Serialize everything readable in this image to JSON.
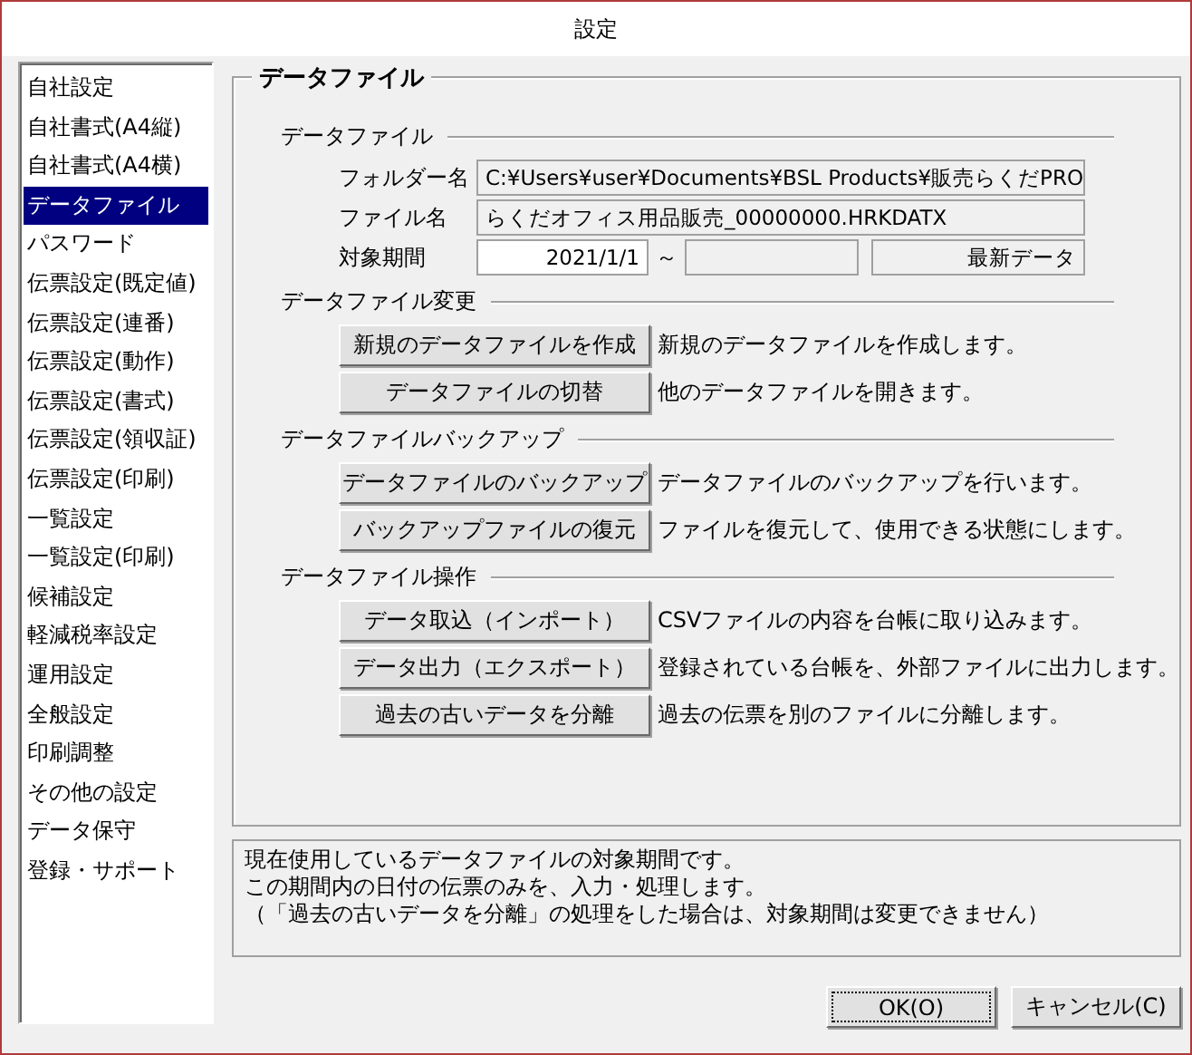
{
  "window": {
    "title": "設定"
  },
  "sidebar": {
    "items": [
      {
        "label": "自社設定",
        "selected": false
      },
      {
        "label": "自社書式(A4縦)",
        "selected": false
      },
      {
        "label": "自社書式(A4横)",
        "selected": false
      },
      {
        "label": "データファイル",
        "selected": true
      },
      {
        "label": "パスワード",
        "selected": false
      },
      {
        "label": "伝票設定(既定値)",
        "selected": false
      },
      {
        "label": "伝票設定(連番)",
        "selected": false
      },
      {
        "label": "伝票設定(動作)",
        "selected": false
      },
      {
        "label": "伝票設定(書式)",
        "selected": false
      },
      {
        "label": "伝票設定(領収証)",
        "selected": false
      },
      {
        "label": "伝票設定(印刷)",
        "selected": false
      },
      {
        "label": "一覧設定",
        "selected": false
      },
      {
        "label": "一覧設定(印刷)",
        "selected": false
      },
      {
        "label": "候補設定",
        "selected": false
      },
      {
        "label": "軽減税率設定",
        "selected": false
      },
      {
        "label": "運用設定",
        "selected": false
      },
      {
        "label": "全般設定",
        "selected": false
      },
      {
        "label": "印刷調整",
        "selected": false
      },
      {
        "label": "その他の設定",
        "selected": false
      },
      {
        "label": "データ保守",
        "selected": false
      },
      {
        "label": "登録・サポート",
        "selected": false
      }
    ]
  },
  "panel": {
    "title": "データファイル",
    "sections": [
      {
        "kind": "fields",
        "title": "データファイル",
        "fields": [
          {
            "kind": "text",
            "label": "フォルダー名",
            "value": "C:¥Users¥user¥Documents¥BSL Products¥販売らくだPRO"
          },
          {
            "kind": "text",
            "label": "ファイル名",
            "value": "らくだオフィス用品販売_00000000.HRKDATX"
          },
          {
            "kind": "range",
            "label": "対象期間",
            "from": "2021/1/1",
            "separator": "～",
            "latest": "最新データ"
          }
        ]
      },
      {
        "kind": "actions",
        "title": "データファイル変更",
        "actions": [
          {
            "label": "新規のデータファイルを作成",
            "description": "新規のデータファイルを作成します。"
          },
          {
            "label": "データファイルの切替",
            "description": "他のデータファイルを開きます。"
          }
        ]
      },
      {
        "kind": "actions",
        "title": "データファイルバックアップ",
        "actions": [
          {
            "label": "データファイルのバックアップ",
            "description": "データファイルのバックアップを行います。"
          },
          {
            "label": "バックアップファイルの復元",
            "description": "ファイルを復元して、使用できる状態にします。"
          }
        ]
      },
      {
        "kind": "actions",
        "title": "データファイル操作",
        "actions": [
          {
            "label": "データ取込（インポート）",
            "description": "CSVファイルの内容を台帳に取り込みます。"
          },
          {
            "label": "データ出力（エクスポート）",
            "description": "登録されている台帳を、外部ファイルに出力します。"
          },
          {
            "label": "過去の古いデータを分離",
            "description": "過去の伝票を別のファイルに分離します。"
          }
        ]
      }
    ]
  },
  "help": [
    "現在使用しているデータファイルの対象期間です。",
    "この期間内の日付の伝票のみを、入力・処理します。",
    "（「過去の古いデータを分離」の処理をした場合は、対象期間は変更できません）"
  ],
  "buttons": [
    {
      "label": "OK(O)",
      "focused": true
    },
    {
      "label": "キャンセル(C)",
      "focused": false
    }
  ]
}
